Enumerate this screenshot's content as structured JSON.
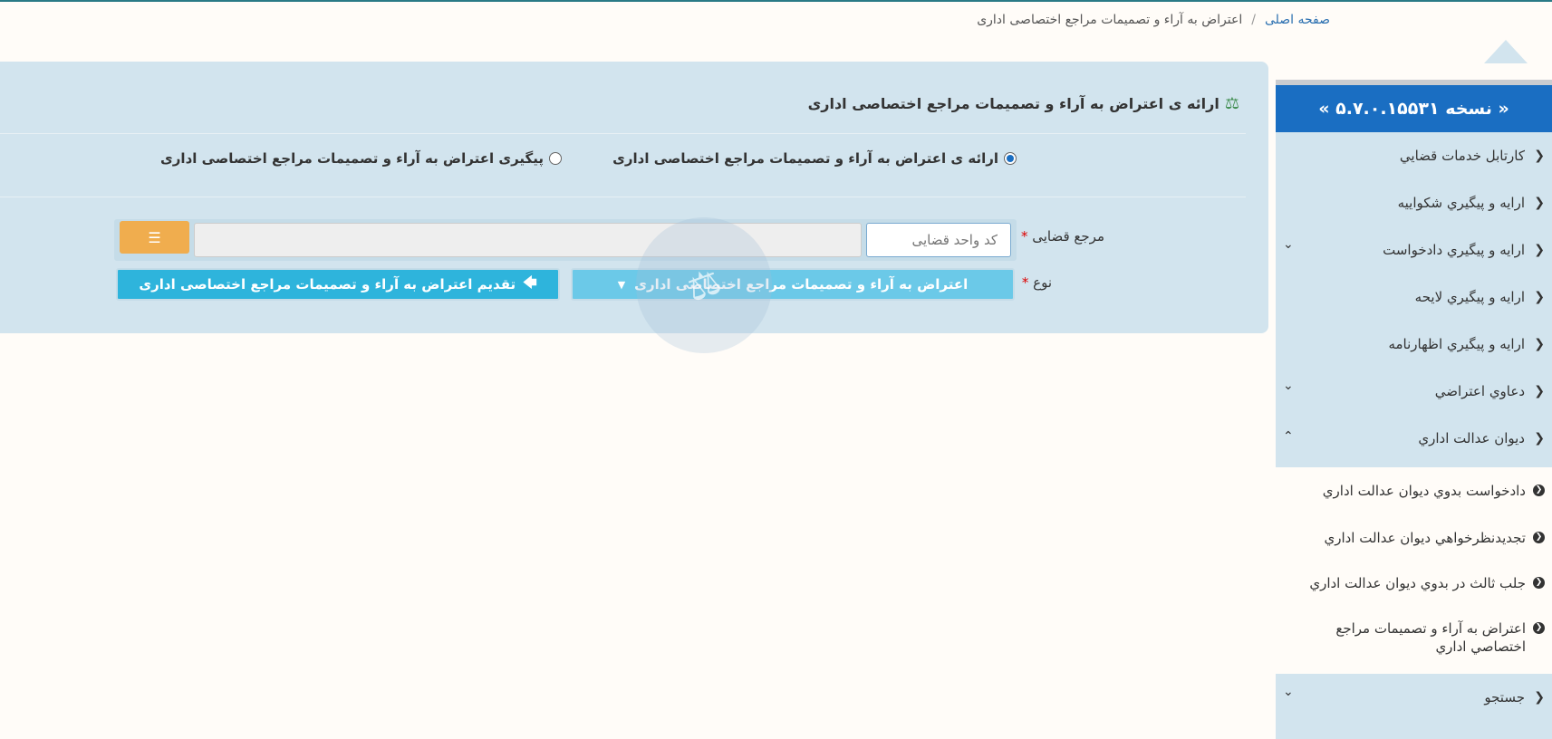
{
  "breadcrumb": {
    "home": "صفحه اصلی",
    "separator": "/",
    "current": "اعتراض به آراء و تصمیمات مراجع اختصاصی اداری"
  },
  "sidebar": {
    "version": "« نسخه ۵.۷.۰.۱۵۵۳۱ »",
    "items": [
      {
        "label": "كارتابل خدمات قضايي"
      },
      {
        "label": "ارايه و پيگيري شكواييه"
      },
      {
        "label": "ارايه و پيگيري دادخواست"
      },
      {
        "label": "ارايه و پيگيري لايحه"
      },
      {
        "label": "ارايه و پيگيري اظهارنامه"
      },
      {
        "label": "دعاوي اعتراضي"
      },
      {
        "label": "ديوان عدالت اداري"
      },
      {
        "label": "جستجو"
      }
    ],
    "submenu": [
      {
        "label": "دادخواست بدوي ديوان عدالت اداري"
      },
      {
        "label": "تجديدنظرخواهي ديوان عدالت اداري"
      },
      {
        "label": "جلب ثالث در بدوي ديوان عدالت اداري"
      },
      {
        "label": "اعتراض به آراء و تصميمات مراجع اختصاصي اداري"
      }
    ]
  },
  "main": {
    "title": "ارائه ی اعتراض به آراء و تصمیمات مراجع اختصاصی اداری",
    "radio_submit": "ارائه ی اعتراض به آراء و تصمیمات مراجع اختصاصی اداری",
    "radio_track": "پیگیری اعتراض به آراء و تصمیمات مراجع اختصاصی اداری",
    "label_authority": "مرجع قضایی",
    "required_mark": "*",
    "code_placeholder": "کد واحد قضایی",
    "label_type": "نوع",
    "type_value": "اعتراض به آراء و تصمیمات مراجع اختصاصی اداری",
    "submit_label": "تقدیم اعتراض به آراء و تصمیمات مراجع اختصاصی اداری"
  },
  "colors": {
    "panel": "#d2e4ee",
    "version_header": "#1a6ec2",
    "list_button": "#f0ad4e",
    "submit_button": "#2eb4dc",
    "dropdown": "#6bc9e8"
  }
}
